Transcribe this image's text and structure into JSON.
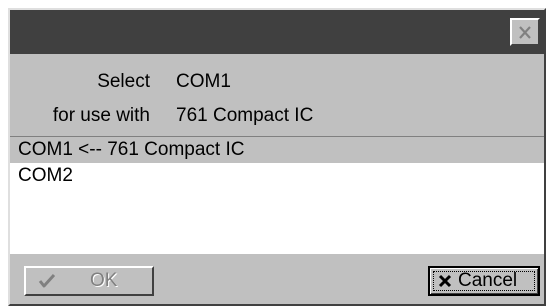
{
  "window": {
    "title": "",
    "close_icon": "close-icon"
  },
  "prompt": {
    "select_label": "Select",
    "select_value": "COM1",
    "for_use_label": "for use with",
    "for_use_value": "761 Compact IC"
  },
  "ports_list": {
    "items": [
      {
        "label": "COM1 <-- 761 Compact IC",
        "selected": true
      },
      {
        "label": "COM2",
        "selected": false
      }
    ]
  },
  "buttons": {
    "ok_label": "OK",
    "ok_icon": "checkmark-icon",
    "ok_enabled": false,
    "cancel_label": "Cancel",
    "cancel_icon": "x-icon"
  },
  "colors": {
    "title_bar": "#404040",
    "dialog_bg": "#c0c0c0",
    "list_selected_bg": "#c0c0c0",
    "disabled_text": "#808080"
  }
}
